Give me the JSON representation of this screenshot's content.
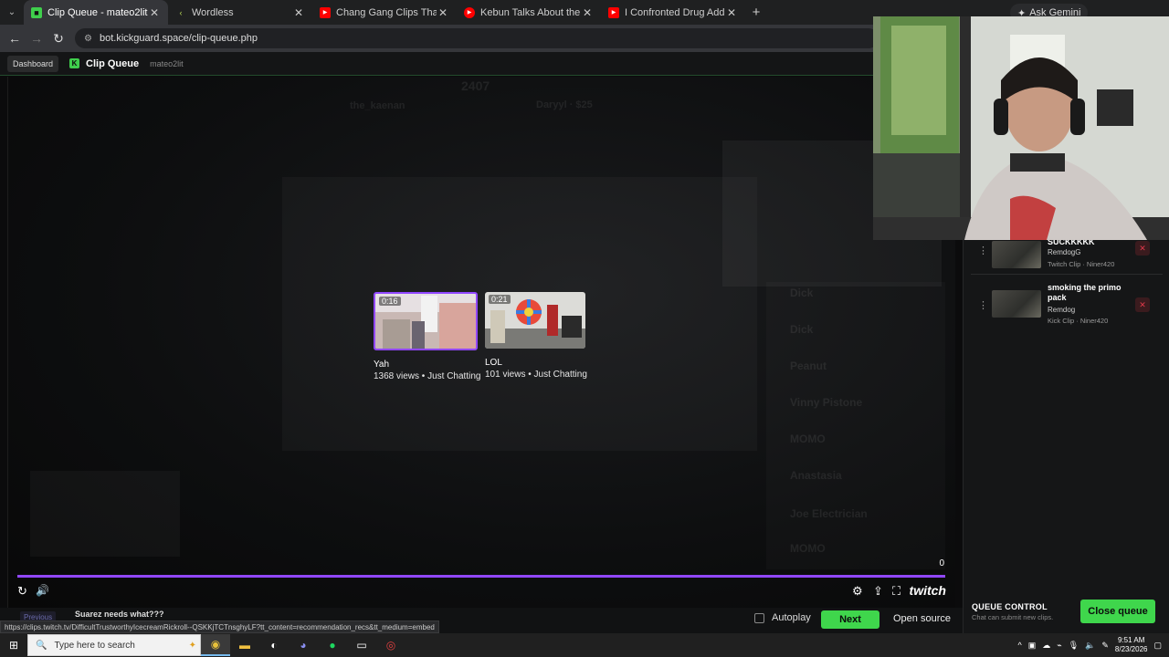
{
  "browser": {
    "tabs": [
      {
        "label": "Clip Queue - mateo2lit",
        "active": true,
        "fav_color": "#3fcf4c"
      },
      {
        "label": "Wordless",
        "active": false,
        "fav_color": "#b4d455"
      },
      {
        "label": "Chang Gang Clips That Takes M",
        "active": false,
        "fav_color": "#ff0000"
      },
      {
        "label": "Kebun Talks About the Future o",
        "active": false,
        "fav_color": "#ff0000"
      },
      {
        "label": "I Confronted Drug Addicts in Se",
        "active": false,
        "fav_color": "#ff0000"
      }
    ],
    "gemini_label": "Ask Gemini",
    "url": "bot.kickguard.space/clip-queue.php"
  },
  "app": {
    "dashboard_label": "Dashboard",
    "title": "Clip Queue",
    "username": "mateo2lit"
  },
  "player": {
    "recommendations": [
      {
        "duration": "0:16",
        "title": "Yah",
        "meta": "1368 views • Just Chatting",
        "selected": true
      },
      {
        "duration": "0:21",
        "title": "LOL",
        "meta": "101 views • Just Chatting",
        "selected": false
      }
    ],
    "counter": "0",
    "progress": 1.0,
    "brand": "twitch",
    "background_text": {
      "count": "2407",
      "top_user_left": "the_kaenan",
      "top_user_right": "Daryyl · $25",
      "names": [
        "Dick",
        "Dick",
        "Peanut",
        "Vinny Pistone",
        "MOMO",
        "Anastasia",
        "Joe Electrician",
        "MOMO"
      ]
    }
  },
  "bottom": {
    "previous_label": "Previous",
    "current_clip": "Suarez needs what???",
    "status_url": "https://clips.twitch.tv/DifficultTrustworthyIcecreamRickroll--QSKKjTCTnsghyLF?tt_content=recommendation_recs&tt_medium=embed",
    "autoplay_label": "Autoplay",
    "next_label": "Next",
    "open_source_label": "Open source"
  },
  "queue": {
    "items": [
      {
        "title": "SUCKKKKK",
        "author": "RemdogG",
        "source": "Twitch Clip · Niner420"
      },
      {
        "title": "smoking the primo pack",
        "author": "Remdog",
        "source": "Kick Clip · Niner420"
      }
    ],
    "control_title": "QUEUE CONTROL",
    "control_sub": "Chat can submit new clips.",
    "close_label": "Close queue"
  },
  "taskbar": {
    "search_placeholder": "Type here to search",
    "time": "9:51 AM",
    "date": "8/23/2026"
  },
  "colors": {
    "accent_green": "#3fd64c",
    "twitch_purple": "#9147ff",
    "delete_red": "#e0394a"
  }
}
